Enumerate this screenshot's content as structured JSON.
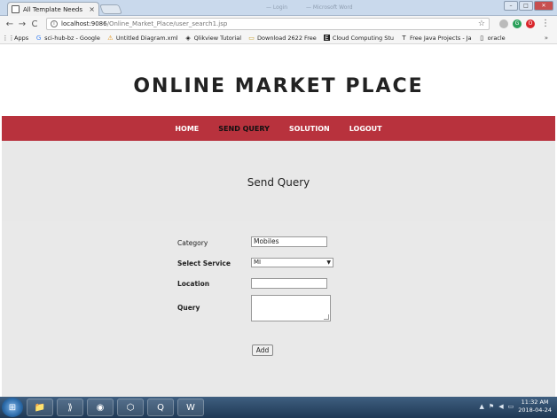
{
  "browser": {
    "tab_title": "All Template Needs",
    "tab_close": "×",
    "ghost_titles": [
      "— Login",
      "— Microsoft Word"
    ],
    "url_host": "localhost:9086",
    "url_path": "/Online_Market_Place/user_search1.jsp",
    "window_buttons": [
      "–",
      "□",
      "✕"
    ],
    "nav_back": "←",
    "nav_forward": "→",
    "nav_reload": "C",
    "star": "☆"
  },
  "bookmarks": [
    {
      "icon": "⋮⋮",
      "label": "Apps"
    },
    {
      "icon": "G",
      "label": "sci-hub-bz - Google"
    },
    {
      "icon": "⚠",
      "label": "Untitled Diagram.xml"
    },
    {
      "icon": "◈",
      "label": "Qlikview Tutorial"
    },
    {
      "icon": "▭",
      "label": "Download 2622 Free"
    },
    {
      "icon": "E",
      "label": "Cloud Computing Stu"
    },
    {
      "icon": "T",
      "label": "Free Java Projects - Ja"
    },
    {
      "icon": "▯",
      "label": "oracle"
    }
  ],
  "bookmarks_more": "»",
  "site": {
    "title": "ONLINE MARKET PLACE",
    "nav": [
      {
        "label": "HOME",
        "active": false
      },
      {
        "label": "SEND QUERY",
        "active": true
      },
      {
        "label": "SOLUTION",
        "active": false
      },
      {
        "label": "LOGOUT",
        "active": false
      }
    ],
    "hero_title": "Send Query"
  },
  "form": {
    "category_label": "Category",
    "category_value": "Mobiles",
    "service_label": "Select Service",
    "service_value": "MI",
    "location_label": "Location",
    "location_value": "",
    "query_label": "Query",
    "query_value": "",
    "add_label": "Add"
  },
  "taskbar": {
    "apps": [
      "📁",
      "⟫",
      "◉",
      "⬡",
      "Q",
      "W"
    ],
    "tray": [
      "▲",
      "⚑",
      "◀",
      "▭"
    ],
    "time": "11:32 AM",
    "date": "2018-04-24"
  },
  "colors": {
    "navbar": "#b8323d",
    "hero_bg": "#e8e8e8"
  }
}
